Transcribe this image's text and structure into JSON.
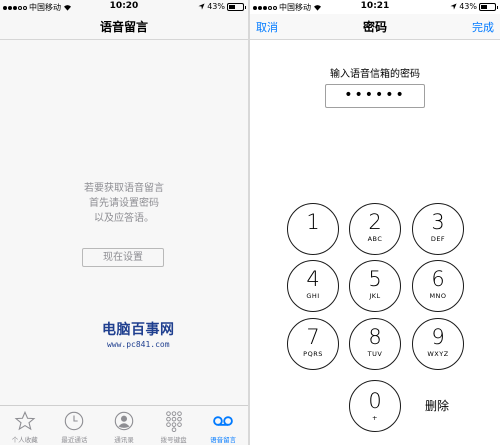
{
  "left": {
    "status": {
      "carrier": "中国移动",
      "time": "10:20",
      "battery_text": "43%",
      "battery_level": 0.43
    },
    "nav": {
      "title": "语音留言"
    },
    "message_lines": [
      "若要获取语音留言",
      "首先请设置密码",
      "以及应答语。"
    ],
    "setup_button": "现在设置",
    "watermark": {
      "line1": "电脑百事网",
      "line2": "www.pc841.com"
    },
    "tabs": [
      {
        "label": "个人收藏",
        "icon": "star-icon"
      },
      {
        "label": "最近通话",
        "icon": "clock-icon"
      },
      {
        "label": "通讯录",
        "icon": "contacts-icon"
      },
      {
        "label": "拨号键盘",
        "icon": "keypad-icon"
      },
      {
        "label": "语音留言",
        "icon": "voicemail-icon",
        "active": true
      }
    ],
    "accent": "#007aff"
  },
  "right": {
    "status": {
      "carrier": "中国移动",
      "time": "10:21",
      "battery_text": "43%",
      "battery_level": 0.43
    },
    "nav": {
      "cancel": "取消",
      "title": "密码",
      "done": "完成"
    },
    "password_label": "输入语音信箱的密码",
    "password_value": "••••••",
    "keys": [
      {
        "num": "1",
        "letters": ""
      },
      {
        "num": "2",
        "letters": "ABC"
      },
      {
        "num": "3",
        "letters": "DEF"
      },
      {
        "num": "4",
        "letters": "GHI"
      },
      {
        "num": "5",
        "letters": "JKL"
      },
      {
        "num": "6",
        "letters": "MNO"
      },
      {
        "num": "7",
        "letters": "PQRS"
      },
      {
        "num": "8",
        "letters": "TUV"
      },
      {
        "num": "9",
        "letters": "WXYZ"
      },
      {
        "num": "0",
        "letters": "+"
      }
    ],
    "delete_label": "删除"
  }
}
